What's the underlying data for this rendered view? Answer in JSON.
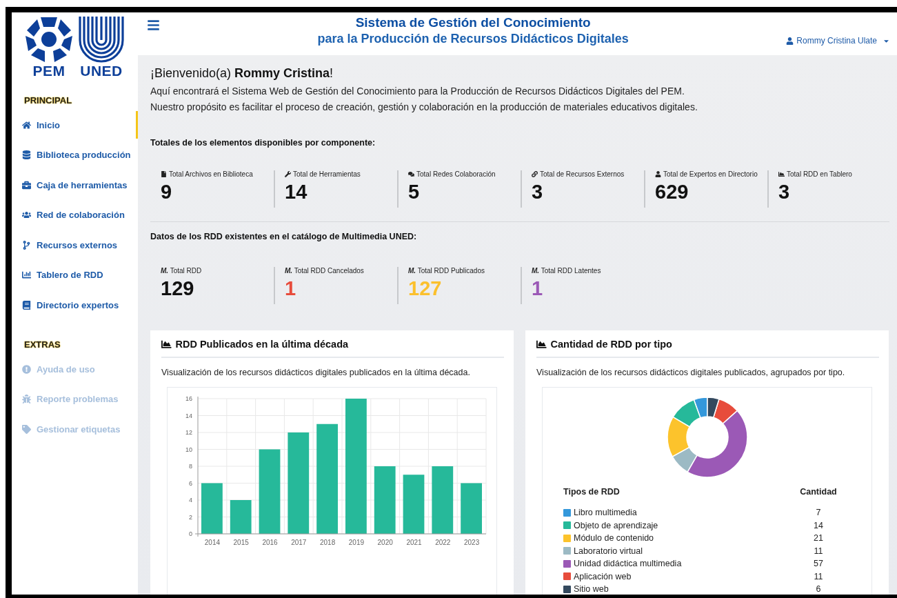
{
  "logos": {
    "left": "PEM",
    "right": "UNED"
  },
  "sidebar": {
    "sections": [
      {
        "title": "PRINCIPAL",
        "items": [
          {
            "label": "Inicio",
            "selected": true,
            "disabled": false
          },
          {
            "label": "Biblioteca producción",
            "selected": false,
            "disabled": false
          },
          {
            "label": "Caja de herramientas",
            "selected": false,
            "disabled": false
          },
          {
            "label": "Red de colaboración",
            "selected": false,
            "disabled": false
          },
          {
            "label": "Recursos externos",
            "selected": false,
            "disabled": false
          },
          {
            "label": "Tablero de RDD",
            "selected": false,
            "disabled": false
          },
          {
            "label": "Directorio expertos",
            "selected": false,
            "disabled": false
          }
        ]
      },
      {
        "title": "EXTRAS",
        "items": [
          {
            "label": "Ayuda de uso",
            "selected": false,
            "disabled": true
          },
          {
            "label": "Reporte problemas",
            "selected": false,
            "disabled": true
          },
          {
            "label": "Gestionar etiquetas",
            "selected": false,
            "disabled": true
          }
        ]
      }
    ]
  },
  "header": {
    "title": "Sistema de Gestión del Conocimiento",
    "subtitle": "para la Producción de Recursos Didácticos Digitales",
    "user": "Rommy Cristina Ulate"
  },
  "welcome": {
    "greeting": "¡Bienvenido(a) **Rommy Cristina**!",
    "lines": [
      "Aquí encontrará el Sistema Web de Gestión del Conocimiento para la Producción de Recursos Didácticos Digitales del PEM.",
      "Nuestro propósito es facilitar el proceso de creación, gestión y colaboración en la producción de materiales educativos digitales."
    ]
  },
  "totals": {
    "heading": "Totales de los elementos disponibles por componente:",
    "stats": [
      {
        "label": "Total Archivos en Biblioteca",
        "value": "9",
        "color": "#111111"
      },
      {
        "label": "Total de Herramientas",
        "value": "14",
        "color": "#111111"
      },
      {
        "label": "Total Redes Colaboración",
        "value": "5",
        "color": "#111111"
      },
      {
        "label": "Total de Recursos Externos",
        "value": "3",
        "color": "#111111"
      },
      {
        "label": "Total de Expertos en Directorio",
        "value": "629",
        "color": "#111111"
      },
      {
        "label": "Total RDD en Tablero",
        "value": "3",
        "color": "#111111"
      }
    ]
  },
  "catalog": {
    "heading": "Datos de los RDD existentes en el catálogo de Multimedia UNED:",
    "stats": [
      {
        "label": "*M.* Total RDD",
        "value": "129",
        "color": "#111111"
      },
      {
        "label": "*M.* Total RDD Cancelados",
        "value": "1",
        "color": "#e74c3c"
      },
      {
        "label": "*M.* Total RDD Publicados",
        "value": "127",
        "color": "#fbc02d"
      },
      {
        "label": "*M.* Total RDD Latentes",
        "value": "1",
        "color": "#9b59b6"
      }
    ]
  },
  "cards": [
    {
      "title": "RDD Publicados en la última década",
      "description": "Visualización de los recursos didácticos digitales publicados en la última década.",
      "chart_data": {
        "type": "bar",
        "categories": [
          "2014",
          "2015",
          "2016",
          "2017",
          "2018",
          "2019",
          "2020",
          "2021",
          "2022",
          "2023"
        ],
        "series": [
          {
            "color": "#26b99a",
            "values": [
              6,
              4,
              10,
              12,
              13,
              16,
              8,
              7,
              8,
              6
            ]
          }
        ],
        "ylim": [
          0,
          16
        ],
        "yticks": [
          0,
          2,
          4,
          6,
          8,
          10,
          12,
          14,
          16
        ],
        "grid": true
      }
    },
    {
      "title": "Cantidad de RDD por tipo",
      "description": "Visualización de los recursos didácticos digitales publicados, agrupados por tipo.",
      "chart_data": {
        "type": "donut",
        "series": [
          {
            "values": [
              5.51,
              11.02,
              16.54,
              8.66,
              44.89,
              8.66,
              4.72
            ]
          }
        ]
      },
      "legend": {
        "columns": [
          "Tipos de RDD",
          "Cantidad"
        ],
        "rows": [
          {
            "label": "Libro multimedia",
            "value": "7",
            "color": "#3498db"
          },
          {
            "label": "Objeto de aprendizaje",
            "value": "14",
            "color": "#26b99a"
          },
          {
            "label": "Módulo de contenido",
            "value": "21",
            "color": "#fcc32c"
          },
          {
            "label": "Laboratorio virtual",
            "value": "11",
            "color": "#9cbac4"
          },
          {
            "label": "Unidad didáctica multimedia",
            "value": "57",
            "color": "#9b59b6"
          },
          {
            "label": "Aplicación web",
            "value": "11",
            "color": "#e74c3c"
          },
          {
            "label": "Sitio web",
            "value": "6",
            "color": "#34495e"
          }
        ]
      }
    }
  ]
}
